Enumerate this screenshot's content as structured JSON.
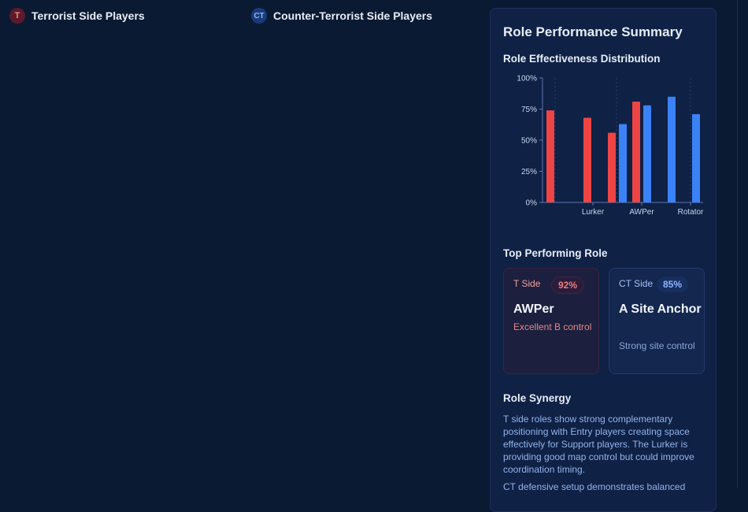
{
  "terrorist": {
    "badge": "T",
    "title": "Terrorist Side Players"
  },
  "counter_terrorist": {
    "badge": "CT",
    "title": "Counter-Terrorist Side Players"
  },
  "panel": {
    "title": "Role Performance Summary",
    "chart_title": "Role Effectiveness Distribution",
    "top_title": "Top Performing Role",
    "t_card": {
      "side": "T Side",
      "pct": "92%",
      "role": "AWPer",
      "desc": "Excellent B control"
    },
    "ct_card": {
      "side": "CT Side",
      "pct": "85%",
      "role": "A Site Anchor",
      "desc": "Strong site control"
    },
    "synergy_title": "Role Synergy",
    "synergy_p1": "T side roles show strong complementary positioning with Entry players creating space effectively for Support players. The Lurker is providing good map control but could improve coordination timing.",
    "synergy_p2": "CT defensive setup demonstrates balanced"
  },
  "colors": {
    "t": "#ef4444",
    "ct": "#3b82f6"
  },
  "chart_data": {
    "type": "bar",
    "x_tick_labels": [
      "Lurker",
      "AWPer",
      "Rotator"
    ],
    "y_ticks": [
      "0%",
      "25%",
      "50%",
      "75%",
      "100%"
    ],
    "ylim": [
      0,
      100
    ],
    "bars": [
      {
        "side": "T",
        "value": 74
      },
      {
        "side": "T",
        "value": 68
      },
      {
        "side": "T",
        "value": 56
      },
      {
        "side": "CT",
        "value": 63
      },
      {
        "side": "T",
        "value": 81
      },
      {
        "side": "CT",
        "value": 78
      },
      {
        "side": "CT",
        "value": 85
      },
      {
        "side": "CT",
        "value": 71
      }
    ]
  }
}
